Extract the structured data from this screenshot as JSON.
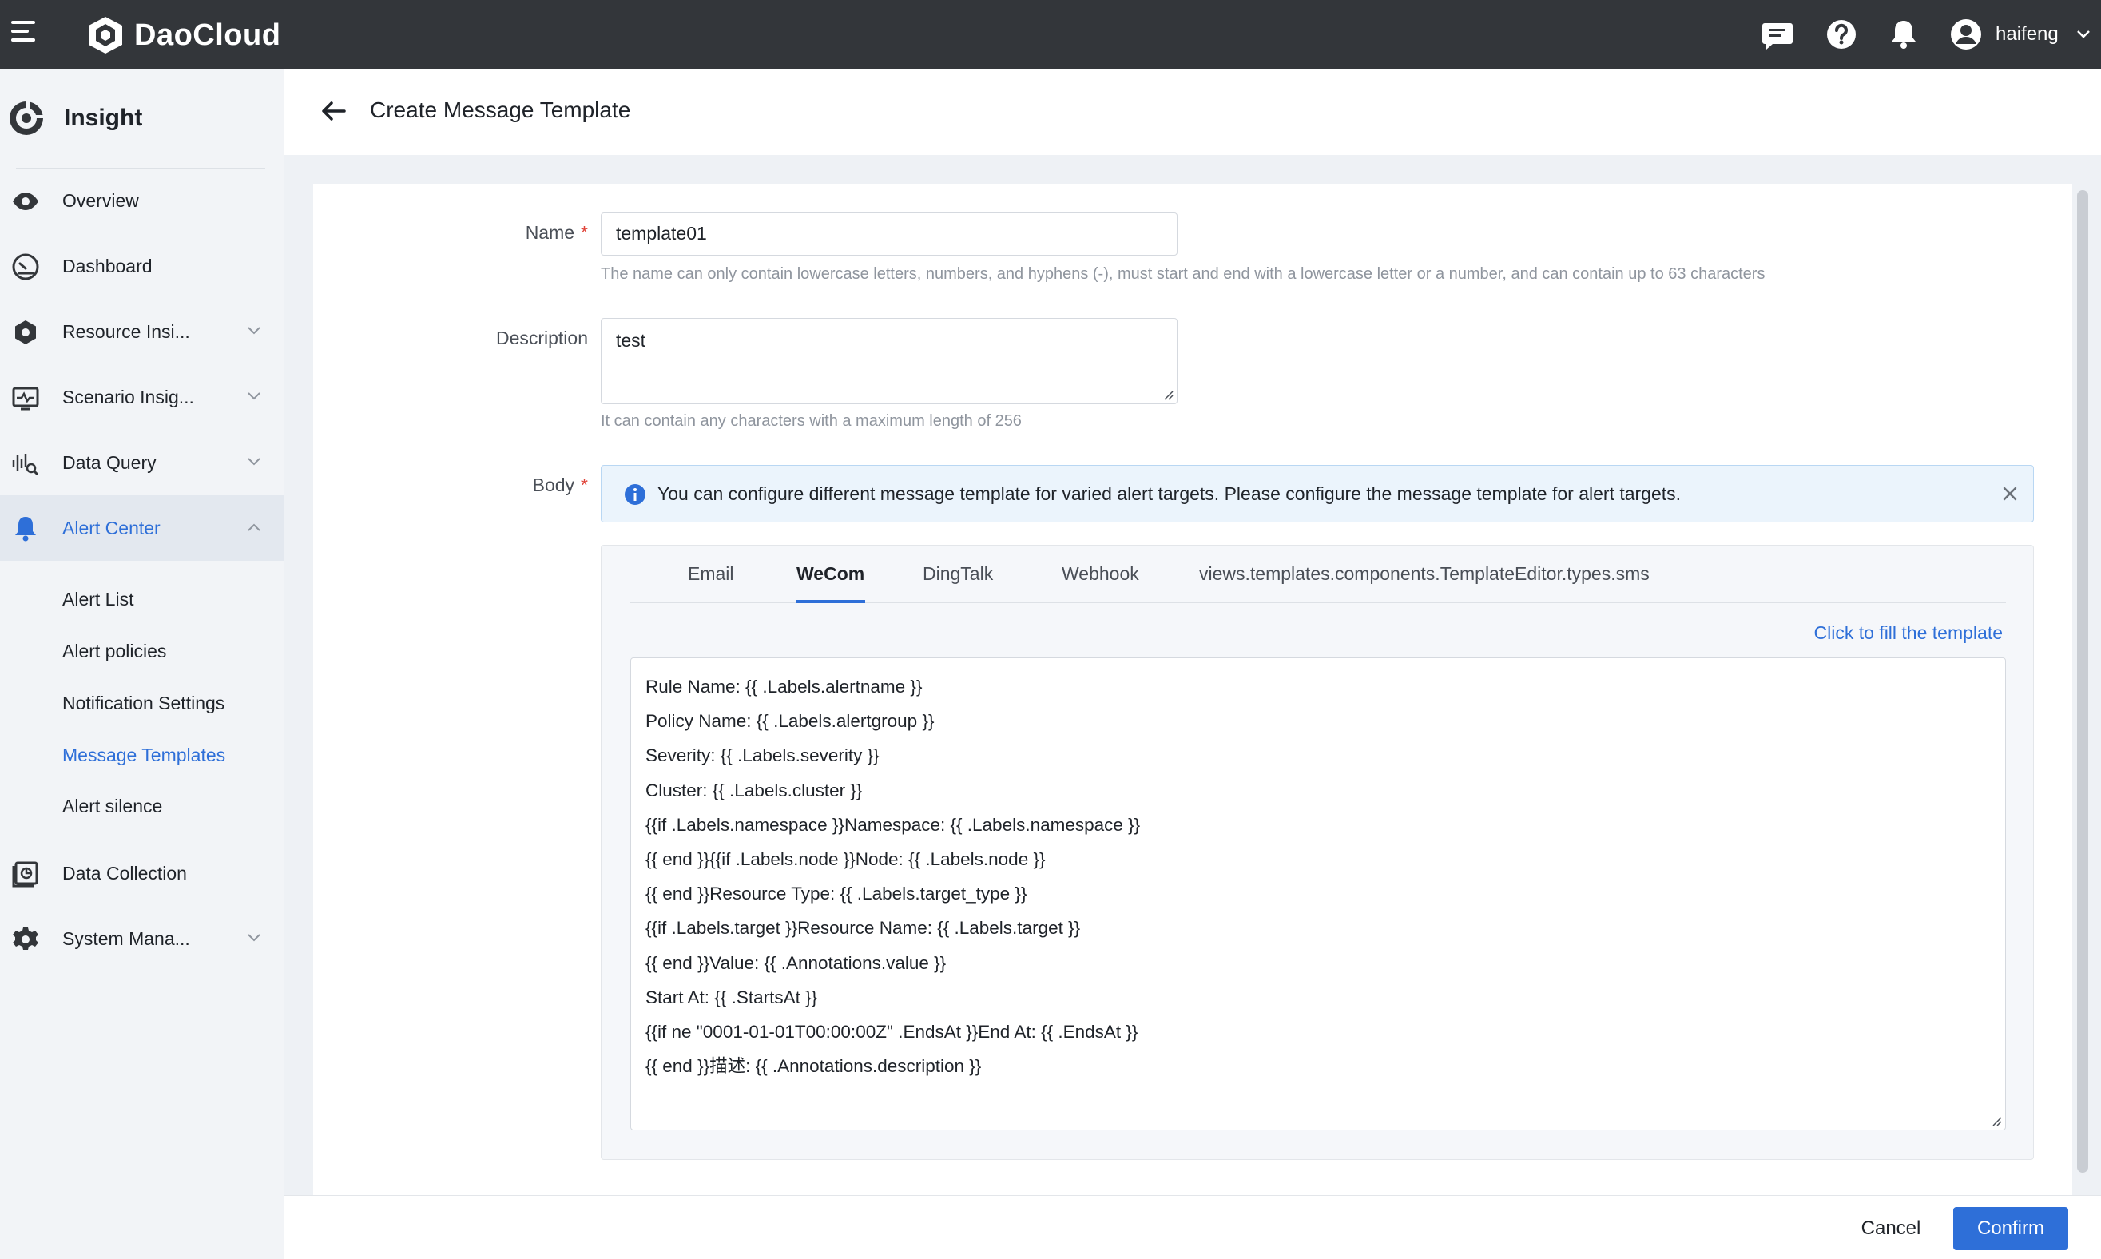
{
  "topbar": {
    "brand": "DaoCloud",
    "user": "haifeng",
    "icons": [
      "hamburger-icon",
      "message-icon",
      "help-icon",
      "bell-icon",
      "user-avatar-icon",
      "chevron-down-icon"
    ]
  },
  "sidebar": {
    "app_title": "Insight",
    "items": [
      {
        "label": "Overview",
        "icon": "eye-icon"
      },
      {
        "label": "Dashboard",
        "icon": "gauge-icon"
      },
      {
        "label": "Resource Insi...",
        "icon": "hexagon-gear-icon"
      },
      {
        "label": "Scenario Insig...",
        "icon": "pulse-monitor-icon"
      },
      {
        "label": "Data Query",
        "icon": "waveform-search-icon"
      },
      {
        "label": "Alert Center",
        "icon": "bell-icon"
      },
      {
        "label": "Data Collection",
        "icon": "data-collection-icon"
      },
      {
        "label": "System Mana...",
        "icon": "gear-icon"
      }
    ],
    "sub_items": [
      "Alert List",
      "Alert policies",
      "Notification Settings",
      "Message Templates",
      "Alert silence"
    ]
  },
  "page": {
    "title": "Create Message Template"
  },
  "form": {
    "name_label": "Name",
    "name_value": "template01",
    "name_hint": "The name can only contain lowercase letters, numbers, and hyphens (-), must start and end with a lowercase letter or a number, and can contain up to 63 characters",
    "description_label": "Description",
    "description_value": "test",
    "description_hint": "It can contain any characters with a maximum length of 256",
    "body_label": "Body",
    "required_mark": "*",
    "alert_text": "You can configure different message template for varied alert targets. Please configure the message template for alert targets.",
    "tabs": [
      "Email",
      "WeCom",
      "DingTalk",
      "Webhook",
      "views.templates.components.TemplateEditor.types.sms"
    ],
    "active_tab": "WeCom",
    "fill_link": "Click to fill the template",
    "template_lines": [
      "Rule Name: {{ .Labels.alertname }}",
      "Policy Name: {{ .Labels.alertgroup }}",
      "Severity: {{ .Labels.severity }}",
      "Cluster: {{ .Labels.cluster }}",
      "{{if .Labels.namespace }}Namespace: {{ .Labels.namespace }}",
      "{{ end }}{{if .Labels.node }}Node: {{ .Labels.node }}",
      "{{ end }}Resource Type: {{ .Labels.target_type }}",
      "{{if .Labels.target }}Resource Name: {{ .Labels.target }}",
      "{{ end }}Value: {{ .Annotations.value }}",
      "Start At: {{ .StartsAt }}",
      "{{if ne \"0001-01-01T00:00:00Z\" .EndsAt }}End At: {{ .EndsAt }}",
      "{{ end }}描述: {{ .Annotations.description }}"
    ]
  },
  "footer": {
    "cancel": "Cancel",
    "confirm": "Confirm"
  },
  "colors": {
    "topbar_bg": "#33363a",
    "accent": "#2e6fd8",
    "sidebar_bg": "#f2f4f7",
    "required": "#e0443a"
  }
}
